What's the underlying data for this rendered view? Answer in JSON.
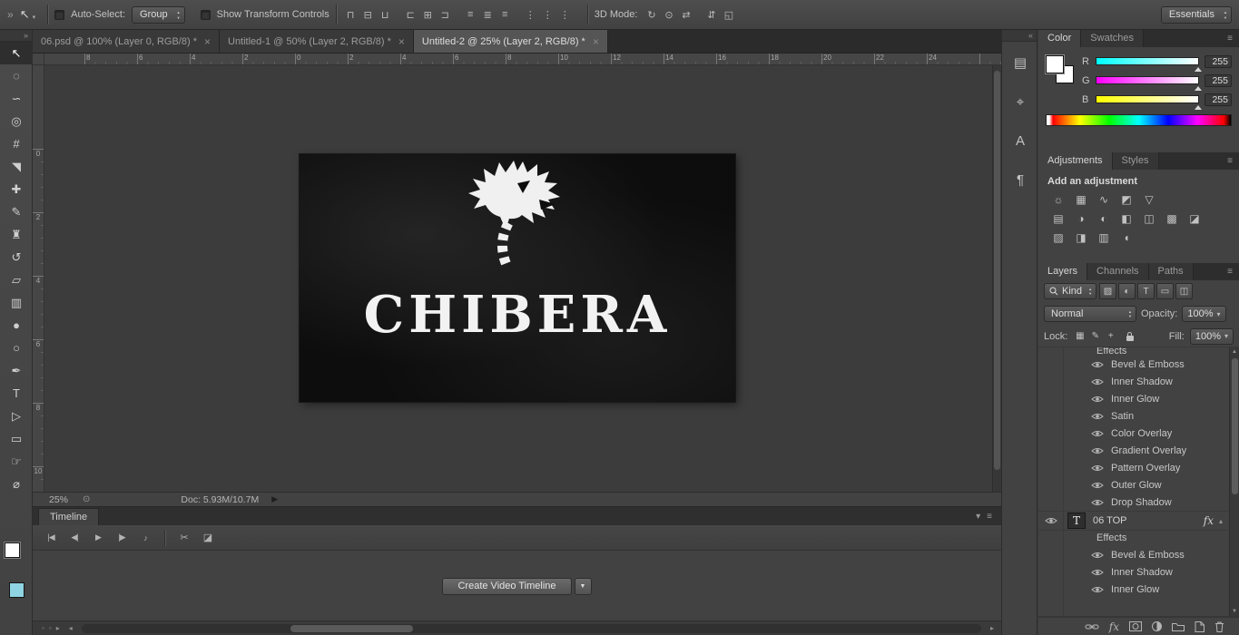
{
  "options_bar": {
    "expand_icon": "»",
    "tool_icon": "↖",
    "auto_select_label": "Auto-Select:",
    "group_value": "Group",
    "show_transform_label": "Show Transform Controls",
    "align_icons": [
      {
        "name": "align-top-edges-icon",
        "glyph": "⊓"
      },
      {
        "name": "align-vertical-centers-icon",
        "glyph": "⊟"
      },
      {
        "name": "align-bottom-edges-icon",
        "glyph": "⊔"
      },
      {
        "name": "align-left-edges-icon",
        "glyph": "⊏"
      },
      {
        "name": "align-horizontal-centers-icon",
        "glyph": "⊞"
      },
      {
        "name": "align-right-edges-icon",
        "glyph": "⊐"
      },
      {
        "name": "distribute-top-edges-icon",
        "glyph": "≡"
      },
      {
        "name": "distribute-vertical-centers-icon",
        "glyph": "≣"
      },
      {
        "name": "distribute-bottom-edges-icon",
        "glyph": "≡"
      },
      {
        "name": "distribute-left-edges-icon",
        "glyph": "⋮"
      },
      {
        "name": "distribute-horizontal-centers-icon",
        "glyph": "⋮"
      },
      {
        "name": "distribute-right-edges-icon",
        "glyph": "⋮"
      }
    ],
    "mode_3d_label": "3D Mode:",
    "mode_3d_icons": [
      {
        "name": "3d-rotate-icon",
        "glyph": "↻"
      },
      {
        "name": "3d-roll-icon",
        "glyph": "⊙"
      },
      {
        "name": "3d-drag-icon",
        "glyph": "⇄"
      },
      {
        "name": "3d-slide-icon",
        "glyph": "⇵"
      },
      {
        "name": "3d-scale-icon",
        "glyph": "◱"
      }
    ],
    "workspace_value": "Essentials"
  },
  "document_tabs": [
    {
      "label": "06.psd @ 100% (Layer 0, RGB/8) *",
      "close_icon": "×",
      "active": false
    },
    {
      "label": "Untitled-1 @ 50% (Layer 2, RGB/8) *",
      "close_icon": "×",
      "active": false
    },
    {
      "label": "Untitled-2 @ 25% (Layer 2, RGB/8) *",
      "close_icon": "×",
      "active": true
    }
  ],
  "toolbar": {
    "collapse_icon": "»",
    "tools": [
      {
        "name": "move-tool",
        "glyph": "↖",
        "active": true
      },
      {
        "name": "marquee-tool",
        "glyph": "◌"
      },
      {
        "name": "lasso-tool",
        "glyph": "∽"
      },
      {
        "name": "quick-selection-tool",
        "glyph": "◎"
      },
      {
        "name": "crop-tool",
        "glyph": "#"
      },
      {
        "name": "eyedropper-tool",
        "glyph": "◥"
      },
      {
        "name": "healing-brush-tool",
        "glyph": "✚"
      },
      {
        "name": "brush-tool",
        "glyph": "✎"
      },
      {
        "name": "clone-stamp-tool",
        "glyph": "♜"
      },
      {
        "name": "history-brush-tool",
        "glyph": "↺"
      },
      {
        "name": "eraser-tool",
        "glyph": "▱"
      },
      {
        "name": "gradient-tool",
        "glyph": "▥"
      },
      {
        "name": "blur-tool",
        "glyph": "●"
      },
      {
        "name": "dodge-tool",
        "glyph": "○"
      },
      {
        "name": "pen-tool",
        "glyph": "✒"
      },
      {
        "name": "type-tool",
        "glyph": "T"
      },
      {
        "name": "path-selection-tool",
        "glyph": "▷"
      },
      {
        "name": "rectangle-tool",
        "glyph": "▭"
      },
      {
        "name": "hand-tool",
        "glyph": "☞"
      },
      {
        "name": "zoom-tool",
        "glyph": "⌀"
      }
    ],
    "foreground_color": "#ffffff",
    "background_color": "#8fd4e2"
  },
  "rulers": {
    "top_numbers": [
      "8",
      "6",
      "4",
      "2",
      "0",
      "2",
      "4",
      "6",
      "8",
      "10",
      "12",
      "14",
      "16",
      "18",
      "20",
      "22",
      "24"
    ],
    "left_numbers": [
      "0",
      "2",
      "4",
      "6",
      "8",
      "10"
    ]
  },
  "canvas": {
    "logo_title": "CHIBERA"
  },
  "status_bar": {
    "zoom": "25%",
    "menu_icon": "⊙",
    "doc_label": "Doc: 5.93M/10.7M",
    "arrow_icon": "▶"
  },
  "timeline": {
    "tab_label": "Timeline",
    "caret_icon": "▾",
    "menu_icon": "≡",
    "transport_icons": [
      {
        "name": "go-to-first-frame-button",
        "glyph": "|◀"
      },
      {
        "name": "previous-frame-button",
        "glyph": "◀|"
      },
      {
        "name": "play-button",
        "glyph": "▶"
      },
      {
        "name": "next-frame-button",
        "glyph": "|▶"
      },
      {
        "name": "audio-mute-button",
        "glyph": "♪"
      }
    ],
    "edit_icons": [
      {
        "name": "split-at-playhead-button",
        "glyph": "✂"
      },
      {
        "name": "transition-button",
        "glyph": "◪"
      }
    ],
    "create_button_label": "Create Video Timeline",
    "scroll_left_icon": "◂",
    "scroll_right_icon": "▸",
    "options_icons": [
      {
        "name": "timeline-frame-option-icon",
        "glyph": "▫"
      },
      {
        "name": "timeline-frame-option-icon",
        "glyph": "▫"
      },
      {
        "name": "timeline-advance-icon",
        "glyph": "▸"
      }
    ]
  },
  "panel_strip": {
    "collapse_icon": "«",
    "icons": [
      {
        "name": "properties-panel-icon",
        "glyph": "▤"
      },
      {
        "name": "clone-source-panel-icon",
        "glyph": "⌖"
      },
      {
        "name": "character-panel-icon",
        "glyph": "A"
      },
      {
        "name": "paragraph-panel-icon",
        "glyph": "¶"
      }
    ]
  },
  "color_panel": {
    "tabs": [
      "Color",
      "Swatches"
    ],
    "menu_icon": "≡",
    "channels": [
      {
        "label": "R",
        "value": "255"
      },
      {
        "label": "G",
        "value": "255"
      },
      {
        "label": "B",
        "value": "255"
      }
    ]
  },
  "adjustments_panel": {
    "tabs": [
      "Adjustments",
      "Styles"
    ],
    "menu_icon": "≡",
    "title": "Add an adjustment",
    "row1": [
      {
        "name": "brightness-contrast-icon",
        "glyph": "☼"
      },
      {
        "name": "levels-icon",
        "glyph": "▦"
      },
      {
        "name": "curves-icon",
        "glyph": "∿"
      },
      {
        "name": "exposure-icon",
        "glyph": "◩"
      },
      {
        "name": "vibrance-icon",
        "glyph": "▽"
      }
    ],
    "row2": [
      {
        "name": "hue-saturation-icon",
        "glyph": "▤"
      },
      {
        "name": "color-balance-icon",
        "glyph": "◑"
      },
      {
        "name": "black-white-icon",
        "glyph": "◐"
      },
      {
        "name": "photo-filter-icon",
        "glyph": "◧"
      },
      {
        "name": "channel-mixer-icon",
        "glyph": "◫"
      },
      {
        "name": "color-lookup-icon",
        "glyph": "▩"
      },
      {
        "name": "invert-icon",
        "glyph": "◪"
      }
    ],
    "row3": [
      {
        "name": "posterize-icon",
        "glyph": "▨"
      },
      {
        "name": "threshold-icon",
        "glyph": "◨"
      },
      {
        "name": "gradient-map-icon",
        "glyph": "▥"
      },
      {
        "name": "selective-color-icon",
        "glyph": "◖"
      }
    ]
  },
  "layers_panel": {
    "tabs": [
      "Layers",
      "Channels",
      "Paths"
    ],
    "menu_icon": "≡",
    "kind_label": "Kind",
    "filter_icons": [
      {
        "name": "filter-pixel-layers-icon",
        "glyph": "▨"
      },
      {
        "name": "filter-adjustment-layers-icon",
        "glyph": "◐"
      },
      {
        "name": "filter-type-layers-icon",
        "glyph": "T"
      },
      {
        "name": "filter-shape-layers-icon",
        "glyph": "▭"
      },
      {
        "name": "filter-smart-objects-icon",
        "glyph": "◫"
      }
    ],
    "blend_mode": "Normal",
    "opacity_label": "Opacity:",
    "opacity_value": "100%",
    "lock_label": "Lock:",
    "lock_icons": [
      {
        "name": "lock-transparent-pixels-icon",
        "glyph": "▦"
      },
      {
        "name": "lock-image-pixels-icon",
        "glyph": "✎"
      },
      {
        "name": "lock-position-icon",
        "glyph": "+"
      }
    ],
    "fill_label": "Fill:",
    "fill_value": "100%",
    "effects_header_1": "Effects",
    "effects_1": [
      "Bevel & Emboss",
      "Inner Shadow",
      "Inner Glow",
      "Satin",
      "Color Overlay",
      "Gradient Overlay",
      "Pattern Overlay",
      "Outer Glow",
      "Drop Shadow"
    ],
    "layer_name": "06 TOP",
    "layer_thumb": "T",
    "fx_label": "fx",
    "effects_header_2": "Effects",
    "effects_2": [
      "Bevel & Emboss",
      "Inner Shadow",
      "Inner Glow"
    ]
  }
}
